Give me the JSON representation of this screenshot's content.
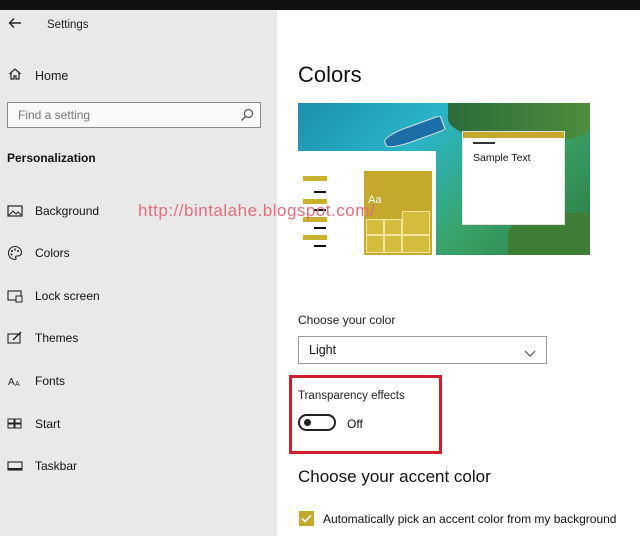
{
  "window": {
    "back_icon": "back-arrow-icon",
    "title": "Settings"
  },
  "sidebar": {
    "home": {
      "icon": "home-icon",
      "label": "Home"
    },
    "search": {
      "placeholder": "Find a setting",
      "icon": "search-icon"
    },
    "section_title": "Personalization",
    "items": [
      {
        "icon": "image-icon",
        "label": "Background"
      },
      {
        "icon": "palette-icon",
        "label": "Colors"
      },
      {
        "icon": "lock-screen-icon",
        "label": "Lock screen"
      },
      {
        "icon": "themes-icon",
        "label": "Themes"
      },
      {
        "icon": "fonts-icon",
        "label": "Fonts"
      },
      {
        "icon": "start-icon",
        "label": "Start"
      },
      {
        "icon": "taskbar-icon",
        "label": "Taskbar"
      }
    ]
  },
  "main": {
    "page_title": "Colors",
    "preview": {
      "sample_text": "Sample Text",
      "tile_text": "Aa",
      "accent_color": "#c4a92c"
    },
    "watermark": "http://bintalahe.blogspot.com/",
    "choose_color": {
      "label": "Choose your color",
      "value": "Light"
    },
    "transparency": {
      "label": "Transparency effects",
      "state": "Off",
      "on": false,
      "highlight_color": "#d21e2b"
    },
    "accent": {
      "title": "Choose your accent color",
      "auto_label": "Automatically pick an accent color from my background",
      "auto_checked": true
    }
  }
}
